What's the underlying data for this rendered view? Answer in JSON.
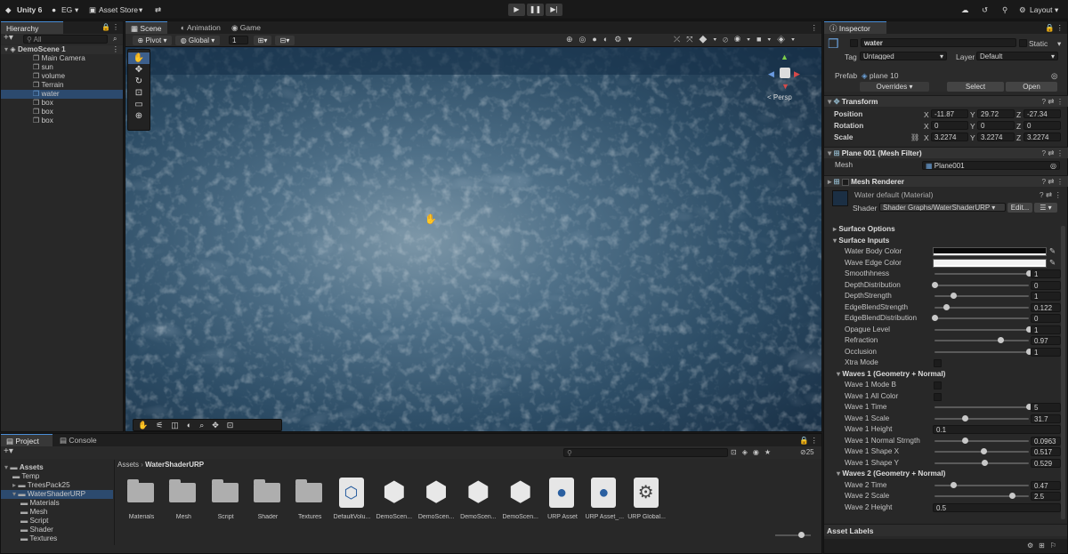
{
  "topbar": {
    "app": "Unity 6",
    "account": "EG",
    "store": "Asset Store",
    "layout": "Layout"
  },
  "hierarchy": {
    "tab": "Hierarchy",
    "search_placeholder": "All",
    "scene": "DemoScene 1",
    "items": [
      "Main Camera",
      "sun",
      "volume",
      "Terrain",
      "water",
      "box",
      "box",
      "box"
    ]
  },
  "scene": {
    "tabs": [
      "Scene",
      "Animation",
      "Game"
    ],
    "pivot": "Pivot",
    "global": "Global",
    "grid_value": "1",
    "persp": "< Persp"
  },
  "project": {
    "tabs": [
      "Project",
      "Console"
    ],
    "tree": [
      "Assets",
      "Temp",
      "TreesPack25",
      "WaterShaderURP",
      "Materials",
      "Mesh",
      "Script",
      "Shader",
      "Textures"
    ],
    "breadcrumb": [
      "Assets",
      "WaterShaderURP"
    ],
    "count": "25",
    "assets": [
      {
        "name": "Materials",
        "kind": "folder"
      },
      {
        "name": "Mesh",
        "kind": "folder"
      },
      {
        "name": "Script",
        "kind": "folder"
      },
      {
        "name": "Shader",
        "kind": "folder"
      },
      {
        "name": "Textures",
        "kind": "folder"
      },
      {
        "name": "DefaultVolu...",
        "kind": "volume"
      },
      {
        "name": "DemoScen...",
        "kind": "unity"
      },
      {
        "name": "DemoScen...",
        "kind": "unity"
      },
      {
        "name": "DemoScen...",
        "kind": "unity"
      },
      {
        "name": "DemoScen...",
        "kind": "unity"
      },
      {
        "name": "URP Asset",
        "kind": "urp"
      },
      {
        "name": "URP Asset_...",
        "kind": "urp"
      },
      {
        "name": "URP Global...",
        "kind": "gear"
      }
    ]
  },
  "inspector": {
    "tab": "Inspector",
    "object_name": "water",
    "static": "Static",
    "tag_label": "Tag",
    "tag": "Untagged",
    "layer_label": "Layer",
    "layer": "Default",
    "prefab_label": "Prefab",
    "prefab": "plane 10",
    "overrides": "Overrides",
    "select": "Select",
    "open": "Open",
    "transform": {
      "title": "Transform",
      "position_label": "Position",
      "rotation_label": "Rotation",
      "scale_label": "Scale",
      "position": [
        "-11.87",
        "29.72",
        "-27.34"
      ],
      "rotation": [
        "0",
        "0",
        "0"
      ],
      "scale": [
        "3.2274",
        "3.2274",
        "3.2274"
      ]
    },
    "mesh_filter": {
      "title": "Plane 001 (Mesh Filter)",
      "mesh_label": "Mesh",
      "mesh": "Plane001"
    },
    "mesh_renderer": {
      "title": "Mesh Renderer"
    },
    "material": {
      "name": "Water default (Material)",
      "shader_label": "Shader",
      "shader": "Shader Graphs/WaterShaderURP",
      "edit": "Edit..."
    },
    "surface_options": "Surface Options",
    "surface_inputs": "Surface Inputs",
    "water_body_color": "Water Body Color",
    "water_edge_color": "Wave Edge Color",
    "sliders": [
      {
        "label": "Smoothhness",
        "value": "1",
        "fraction": 1.0
      },
      {
        "label": "DepthDistribution",
        "value": "0",
        "fraction": 0.0
      },
      {
        "label": "DepthStrength",
        "value": "1",
        "fraction": 0.2
      },
      {
        "label": "EdgeBlendStrength",
        "value": "0.122",
        "fraction": 0.12
      },
      {
        "label": "EdgeBlendDistribution",
        "value": "0",
        "fraction": 0.0
      },
      {
        "label": "Opague Level",
        "value": "1",
        "fraction": 1.0
      },
      {
        "label": "Refraction",
        "value": "0.97",
        "fraction": 0.7
      },
      {
        "label": "Occlusion",
        "value": "1",
        "fraction": 1.0
      }
    ],
    "xtra_mode": "Xtra Mode",
    "waves1": {
      "title": "Waves 1 (Geometry + Normal)",
      "mode_b": "Wave 1 Mode B",
      "all_color": "Wave 1 All Color",
      "sliders": [
        {
          "label": "Wave 1 Time",
          "value": "5",
          "fraction": 1.0
        },
        {
          "label": "Wave 1 Scale",
          "value": "31.7",
          "fraction": 0.32
        }
      ],
      "height_label": "Wave 1 Height",
      "height": "0.1",
      "sliders2": [
        {
          "label": "Wave 1 Normal Strngth",
          "value": "0.0963",
          "fraction": 0.32
        },
        {
          "label": "Wave 1 Shape X",
          "value": "0.517",
          "fraction": 0.52
        },
        {
          "label": "Wave 1 Shape Y",
          "value": "0.529",
          "fraction": 0.53
        }
      ]
    },
    "waves2": {
      "title": "Waves 2 (Geometry + Normal)",
      "sliders": [
        {
          "label": "Wave 2 Time",
          "value": "0.47",
          "fraction": 0.2
        },
        {
          "label": "Wave 2 Scale",
          "value": "2.5",
          "fraction": 0.82
        }
      ],
      "height_label": "Wave 2 Height",
      "height": "0.5"
    },
    "asset_labels": "Asset Labels"
  },
  "colors": {
    "accent": "#4a8ed8",
    "selection": "#2c4a6e",
    "panel": "#282828",
    "background": "#191919"
  }
}
